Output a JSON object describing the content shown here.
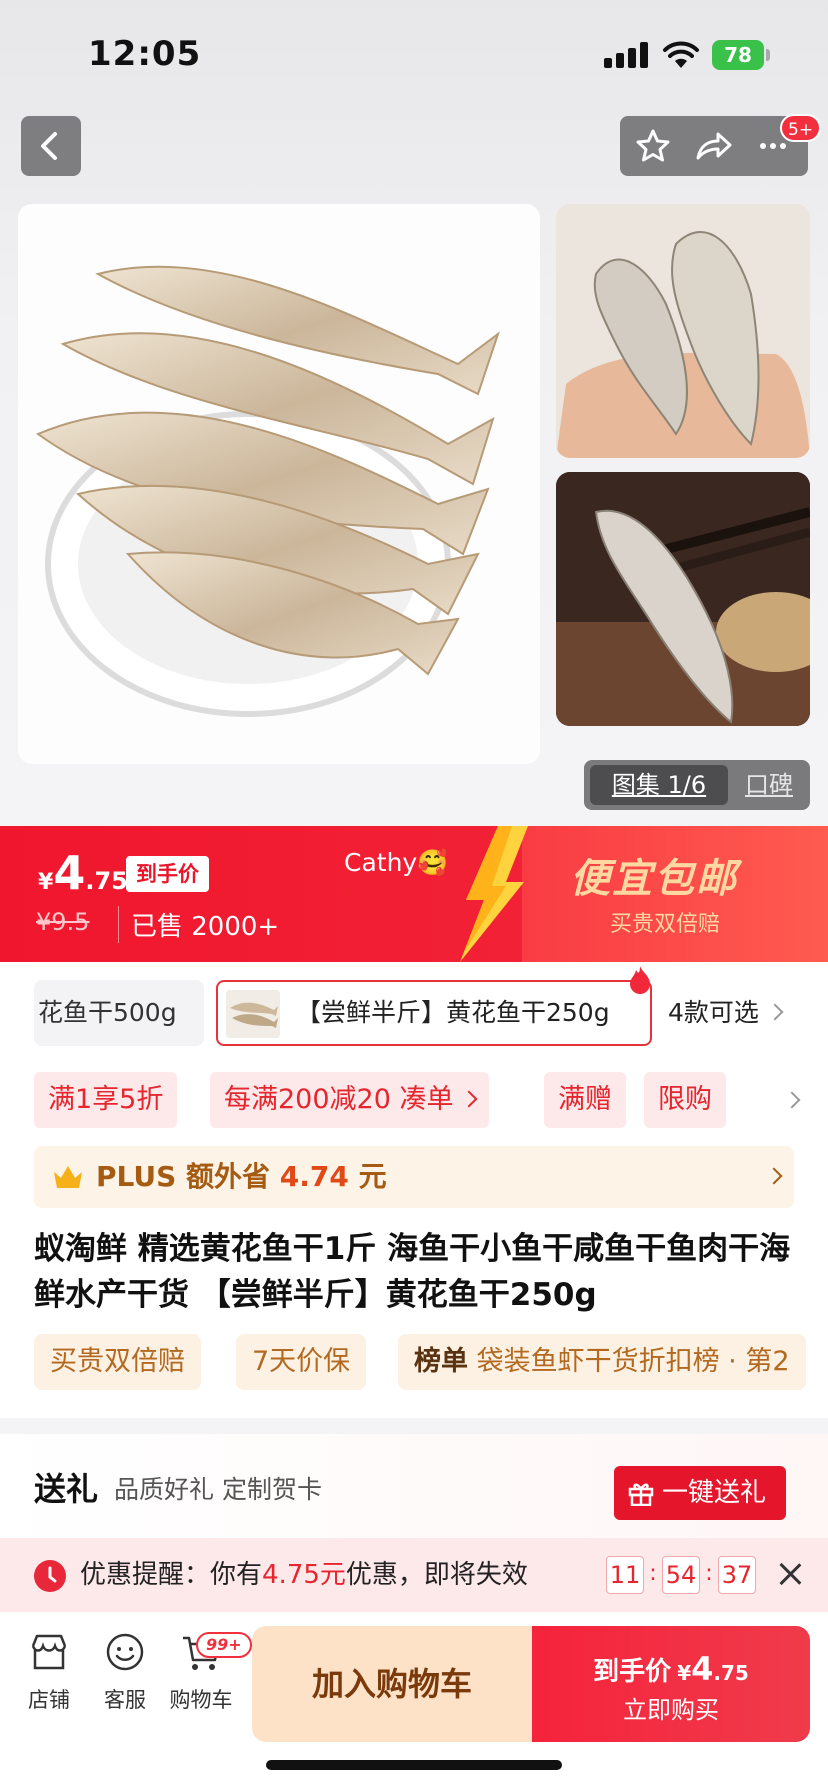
{
  "status_bar": {
    "time": "12:05",
    "battery": "78"
  },
  "header": {
    "more_badge": "5+"
  },
  "gallery": {
    "tab_active": "图集 1/6",
    "tab_other": "口碑"
  },
  "price": {
    "currency": "¥",
    "integer": "4",
    "decimal": ".75",
    "tag": "到手价",
    "original": "¥9.5",
    "sold": "已售 2000+"
  },
  "overlay_text": "Cathy🥰",
  "promo": {
    "title": "便宜包邮",
    "subtitle": "买贵双倍赔"
  },
  "sku": {
    "item_1": "花鱼干500g",
    "item_2": "【尝鲜半斤】黄花鱼干250g",
    "more": "4款可选"
  },
  "promo_tags": [
    "满1享5折",
    "每满200减20 凑单",
    "满赠",
    "限购"
  ],
  "plus": {
    "prefix": "PLUS 额外省 ",
    "amount": "4.74",
    "suffix": " 元"
  },
  "title": "蚁淘鲜 精选黄花鱼干1斤 海鱼干小鱼干咸鱼干鱼肉干海鲜水产干货 【尝鲜半斤】黄花鱼干250g",
  "service_tags": {
    "tag_1": "买贵双倍赔",
    "tag_2": "7天价保",
    "rank_label": "榜单",
    "rank_text": " 袋装鱼虾干货折扣榜 · 第2"
  },
  "gift": {
    "title": "送礼",
    "subtitle": "品质好礼 定制贺卡",
    "button": "一键送礼"
  },
  "reminder": {
    "prefix": "优惠提醒：你有",
    "amount": "4.75元",
    "suffix": "优惠，即将失效",
    "hours": "11",
    "minutes": "54",
    "seconds": "37",
    "separator": ":"
  },
  "bottom_nav": {
    "store": "店铺",
    "service": "客服",
    "cart": "购物车",
    "cart_badge": "99+"
  },
  "actions": {
    "add_to_cart": "加入购物车",
    "buy_label": "到手价",
    "buy_currency": "¥",
    "buy_int": "4",
    "buy_dec": ".75",
    "buy_now": "立即购买"
  },
  "colors": {
    "brand_red": "#f0162d",
    "promo_gold": "#ffd7a1",
    "plus_brown": "#a55b12",
    "cart_bg": "#fde2c8"
  }
}
